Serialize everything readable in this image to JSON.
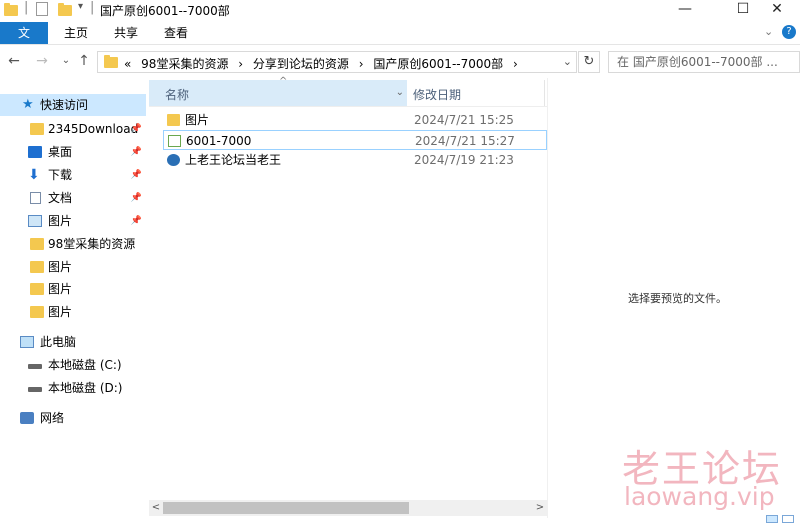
{
  "window": {
    "title": "国产原创6001--7000部",
    "minimize": "—",
    "maximize": "☐",
    "close": "✕"
  },
  "ribbon": {
    "tabs": [
      "文件",
      "主页",
      "共享",
      "查看"
    ],
    "toggle": "⌄",
    "help": "?"
  },
  "nav": {
    "back": "←",
    "forward": "→",
    "recent": "⌄",
    "up": "↑",
    "overflow": "«",
    "breadcrumbs": [
      "98堂采集的资源",
      "›",
      "分享到论坛的资源",
      "›",
      "国产原创6001--7000部",
      "›"
    ],
    "dropdown": "⌄",
    "refresh": "↻",
    "search_placeholder": "在 国产原创6001--7000部 ..."
  },
  "sidebar": {
    "quick_access": "快速访问",
    "items": [
      {
        "label": "2345Download",
        "pinned": true,
        "icon": "folder-icon"
      },
      {
        "label": "桌面",
        "pinned": true,
        "icon": "desktop-icon"
      },
      {
        "label": "下载",
        "pinned": true,
        "icon": "download-icon"
      },
      {
        "label": "文档",
        "pinned": true,
        "icon": "document-icon"
      },
      {
        "label": "图片",
        "pinned": true,
        "icon": "picture-icon"
      },
      {
        "label": "98堂采集的资源",
        "pinned": false,
        "icon": "folder-icon"
      },
      {
        "label": "图片",
        "pinned": false,
        "icon": "folder-icon"
      },
      {
        "label": "图片",
        "pinned": false,
        "icon": "folder-icon"
      },
      {
        "label": "图片",
        "pinned": false,
        "icon": "folder-icon"
      }
    ],
    "this_pc": "此电脑",
    "drives": [
      "本地磁盘 (C:)",
      "本地磁盘 (D:)"
    ],
    "network": "网络",
    "pin_glyph": "📌"
  },
  "filelist": {
    "headers": {
      "name": "名称",
      "date": "修改日期",
      "sort": "^",
      "dropdown": "⌄"
    },
    "rows": [
      {
        "name": "图片",
        "date": "2024/7/21 15:25",
        "icon": "folder-icon"
      },
      {
        "name": "6001-7000",
        "date": "2024/7/21 15:27",
        "icon": "text-file-icon"
      },
      {
        "name": "上老王论坛当老王",
        "date": "2024/7/19 21:23",
        "icon": "internet-shortcut-icon"
      }
    ]
  },
  "scrollbar": {
    "left": "<",
    "right": ">"
  },
  "preview": {
    "message": "选择要预览的文件。"
  },
  "watermark": {
    "line1": "老王论坛",
    "line2": "laowang.vip"
  }
}
